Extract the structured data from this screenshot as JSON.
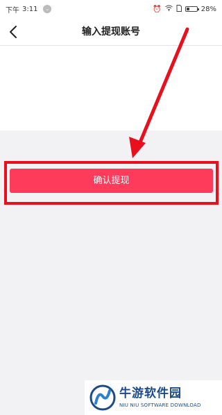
{
  "status_bar": {
    "time_prefix": "下午",
    "time": "3:11",
    "battery_text": "28%",
    "battery_level": 0.28
  },
  "nav": {
    "title": "输入提现账号"
  },
  "main": {
    "confirm_label": "确认提现"
  },
  "annotation": {
    "color": "#e8101d"
  },
  "watermark": {
    "title": "牛游软件园",
    "subtitle": "NIU NIU SOFTWARE DOWNLOAD"
  },
  "colors": {
    "accent": "#ff3b5c",
    "background": "#f2f2f5"
  }
}
